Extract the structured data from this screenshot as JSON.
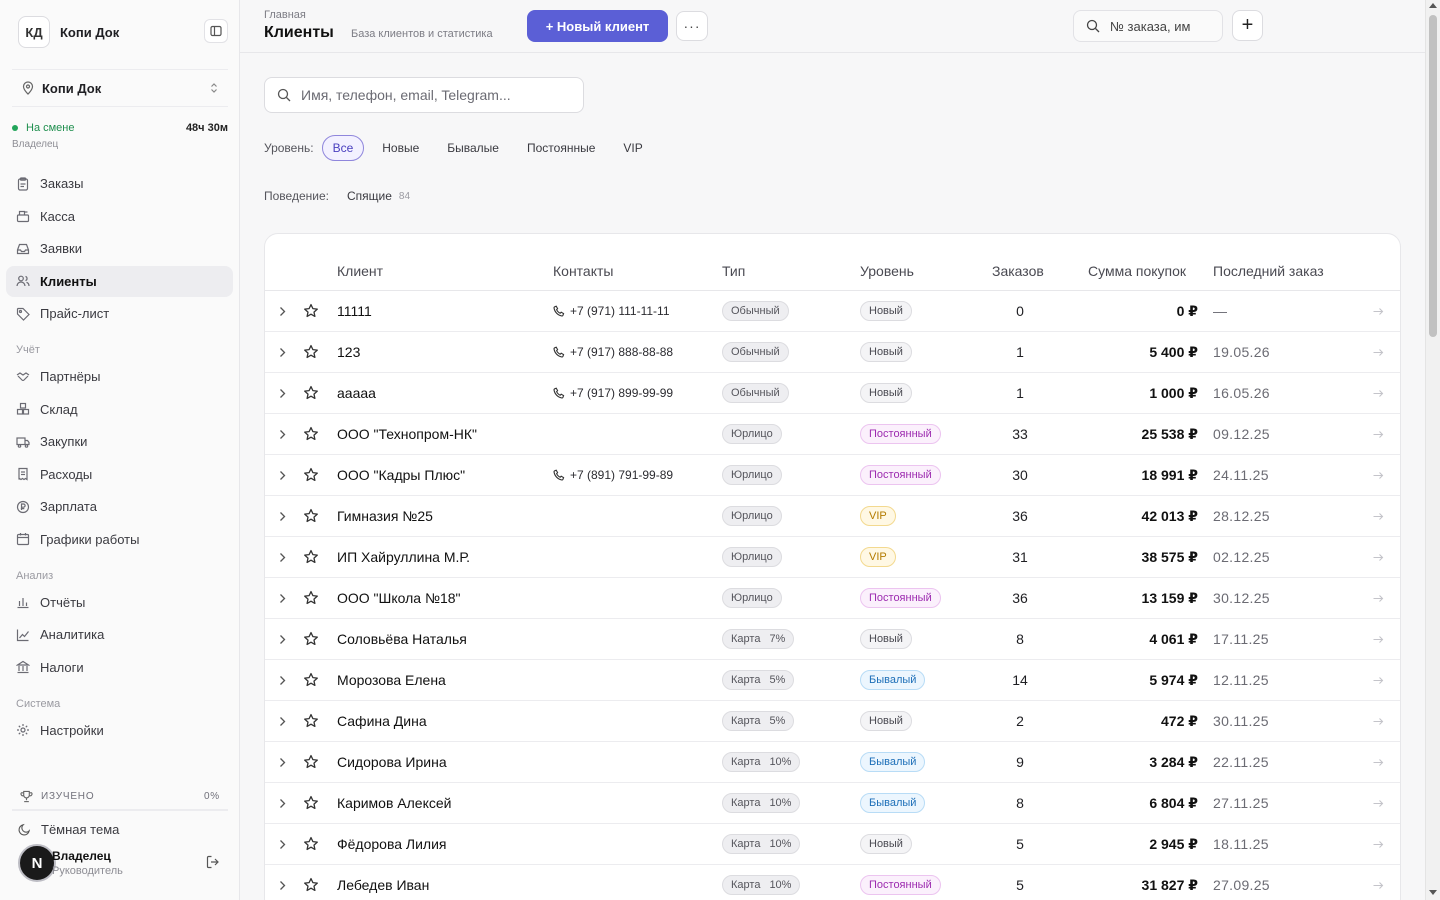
{
  "sidebar": {
    "brand_initials": "КД",
    "brand_name": "Копи Док",
    "workspace": "Копи Док",
    "shift_status": "На смене",
    "shift_time": "48ч 30м",
    "shift_role": "Владелец",
    "main_items": [
      {
        "label": "Заказы",
        "icon": "clipboard-icon"
      },
      {
        "label": "Касса",
        "icon": "register-icon"
      },
      {
        "label": "Заявки",
        "icon": "inbox-icon"
      },
      {
        "label": "Клиенты",
        "icon": "users-icon",
        "active": true
      },
      {
        "label": "Прайс-лист",
        "icon": "tag-icon"
      }
    ],
    "section_accounting": "Учёт",
    "accounting_items": [
      {
        "label": "Партнёры",
        "icon": "handshake-icon"
      },
      {
        "label": "Склад",
        "icon": "boxes-icon"
      },
      {
        "label": "Закупки",
        "icon": "truck-icon"
      },
      {
        "label": "Расходы",
        "icon": "receipt-icon"
      },
      {
        "label": "Зарплата",
        "icon": "coin-icon"
      },
      {
        "label": "Графики работы",
        "icon": "calendar-icon"
      }
    ],
    "section_analysis": "Анализ",
    "analysis_items": [
      {
        "label": "Отчёты",
        "icon": "bar-chart-icon"
      },
      {
        "label": "Аналитика",
        "icon": "line-chart-icon"
      },
      {
        "label": "Налоги",
        "icon": "bank-icon"
      }
    ],
    "section_system": "Система",
    "system_items": [
      {
        "label": "Настройки",
        "icon": "gear-icon"
      }
    ],
    "learned_label": "ИЗУЧЕНО",
    "learned_value": "0%",
    "learned_progress": 0,
    "theme_label": "Тёмная тема",
    "user_initial": "N",
    "user_name": "Владелец",
    "user_role": "Руководитель"
  },
  "header": {
    "breadcrumb": "Главная",
    "title": "Клиенты",
    "subtitle": "База клиентов и статистика",
    "new_client_label": "+ Новый клиент",
    "more_label": "···",
    "order_search_placeholder": "№ заказа, имя",
    "plus_label": "+"
  },
  "search": {
    "placeholder": "Имя, телефон, email, Telegram..."
  },
  "filters": {
    "level_label": "Уровень:",
    "levels": [
      "Все",
      "Новые",
      "Бывалые",
      "Постоянные",
      "VIP"
    ],
    "active_level": "Все",
    "behavior_label": "Поведение:",
    "behavior_chip": "Спящие",
    "behavior_count": "84"
  },
  "table": {
    "columns": [
      "Клиент",
      "Контакты",
      "Тип",
      "Уровень",
      "Заказов",
      "Сумма покупок",
      "Последний заказ"
    ],
    "rows": [
      {
        "name": "11111",
        "phone": "+7 (971) 111-11-11",
        "type": "Обычный",
        "discount": "",
        "level": "Новый",
        "level_style": "new",
        "orders": "0",
        "sum": "0 ₽",
        "last": "—"
      },
      {
        "name": "123",
        "phone": "+7 (917) 888-88-88",
        "type": "Обычный",
        "discount": "",
        "level": "Новый",
        "level_style": "new",
        "orders": "1",
        "sum": "5 400 ₽",
        "last": "19.05.26"
      },
      {
        "name": "ааааа",
        "phone": "+7 (917) 899-99-99",
        "type": "Обычный",
        "discount": "",
        "level": "Новый",
        "level_style": "new",
        "orders": "1",
        "sum": "1 000 ₽",
        "last": "16.05.26"
      },
      {
        "name": "ООО \"Технопром-НК\"",
        "phone": "",
        "type": "Юрлицо",
        "discount": "",
        "level": "Постоянный",
        "level_style": "regular",
        "orders": "33",
        "sum": "25 538 ₽",
        "last": "09.12.25"
      },
      {
        "name": "ООО \"Кадры Плюс\"",
        "phone": "+7 (891) 791-99-89",
        "type": "Юрлицо",
        "discount": "",
        "level": "Постоянный",
        "level_style": "regular",
        "orders": "30",
        "sum": "18 991 ₽",
        "last": "24.11.25"
      },
      {
        "name": "Гимназия №25",
        "phone": "",
        "type": "Юрлицо",
        "discount": "",
        "level": "VIP",
        "level_style": "vip",
        "orders": "36",
        "sum": "42 013 ₽",
        "last": "28.12.25"
      },
      {
        "name": "ИП Хайруллина М.Р.",
        "phone": "",
        "type": "Юрлицо",
        "discount": "",
        "level": "VIP",
        "level_style": "vip",
        "orders": "31",
        "sum": "38 575 ₽",
        "last": "02.12.25"
      },
      {
        "name": "ООО \"Школа №18\"",
        "phone": "",
        "type": "Юрлицо",
        "discount": "",
        "level": "Постоянный",
        "level_style": "regular",
        "orders": "36",
        "sum": "13 159 ₽",
        "last": "30.12.25"
      },
      {
        "name": "Соловьёва Наталья",
        "phone": "",
        "type": "Карта",
        "discount": "7%",
        "level": "Новый",
        "level_style": "new",
        "orders": "8",
        "sum": "4 061 ₽",
        "last": "17.11.25"
      },
      {
        "name": "Морозова Елена",
        "phone": "",
        "type": "Карта",
        "discount": "5%",
        "level": "Бывалый",
        "level_style": "returning",
        "orders": "14",
        "sum": "5 974 ₽",
        "last": "12.11.25"
      },
      {
        "name": "Сафина Дина",
        "phone": "",
        "type": "Карта",
        "discount": "5%",
        "level": "Новый",
        "level_style": "new",
        "orders": "2",
        "sum": "472 ₽",
        "last": "30.11.25"
      },
      {
        "name": "Сидорова Ирина",
        "phone": "",
        "type": "Карта",
        "discount": "10%",
        "level": "Бывалый",
        "level_style": "returning",
        "orders": "9",
        "sum": "3 284 ₽",
        "last": "22.11.25"
      },
      {
        "name": "Каримов Алексей",
        "phone": "",
        "type": "Карта",
        "discount": "10%",
        "level": "Бывалый",
        "level_style": "returning",
        "orders": "8",
        "sum": "6 804 ₽",
        "last": "27.11.25"
      },
      {
        "name": "Фёдорова Лилия",
        "phone": "",
        "type": "Карта",
        "discount": "10%",
        "level": "Новый",
        "level_style": "new",
        "orders": "5",
        "sum": "2 945 ₽",
        "last": "18.11.25"
      },
      {
        "name": "Лебедев Иван",
        "phone": "",
        "type": "Карта",
        "discount": "10%",
        "level": "Постоянный",
        "level_style": "regular",
        "orders": "5",
        "sum": "31 827 ₽",
        "last": "27.09.25"
      }
    ]
  },
  "colors": {
    "accent": "#5b5fd6",
    "level_regular": "#9d2bb0",
    "level_vip": "#b37b00",
    "level_returning": "#1d6fb8",
    "on_shift": "#22a55a"
  }
}
